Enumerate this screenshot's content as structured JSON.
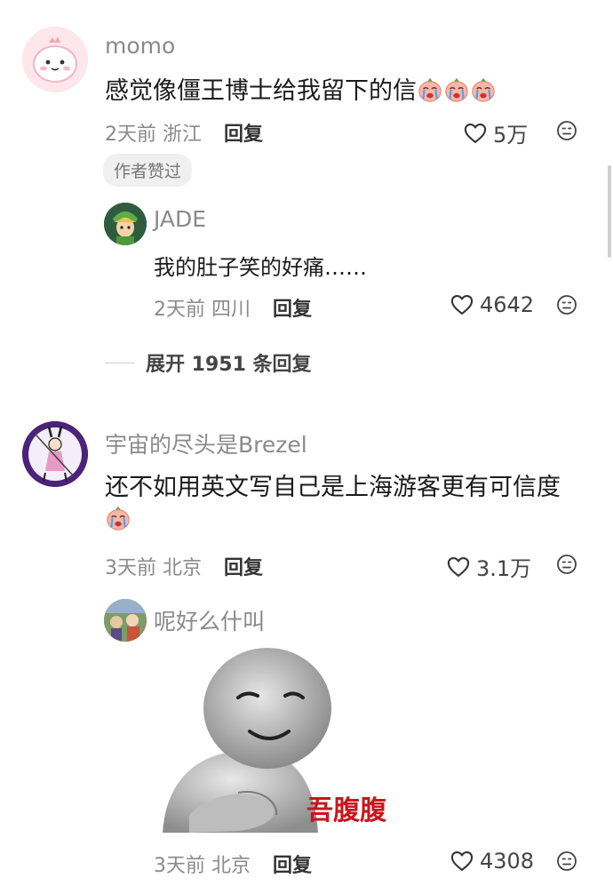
{
  "comments": [
    {
      "username": "momo",
      "text": "感觉像僵王博士给我留下的信",
      "emojis": [
        "crying-face-emoji",
        "crying-face-emoji",
        "crying-face-emoji"
      ],
      "time": "2天前",
      "location": "浙江",
      "reply_label": "回复",
      "likes": "5万",
      "badge": "作者赞过",
      "replies": [
        {
          "username": "JADE",
          "text": "我的肚子笑的好痛……",
          "time": "2天前",
          "location": "四川",
          "reply_label": "回复",
          "likes": "4642"
        }
      ],
      "expand_label": "展开 1951 条回复"
    },
    {
      "username": "宇宙的尽头是Brezel",
      "text": "还不如用英文写自己是上海游客更有可信度",
      "emojis": [
        "crying-face-emoji"
      ],
      "time": "3天前",
      "location": "北京",
      "reply_label": "回复",
      "likes": "3.1万",
      "replies": [
        {
          "username": "呢好么什叫",
          "sticker_caption": "吾腹腹",
          "time": "3天前",
          "location": "北京",
          "reply_label": "回复",
          "likes": "4308"
        }
      ]
    }
  ],
  "colors": {
    "background": "#ffffff",
    "username": "#8a8a8a",
    "text": "#1a1a1a",
    "sticker_caption": "#c8161d",
    "badge_bg": "#f0f0f0"
  }
}
